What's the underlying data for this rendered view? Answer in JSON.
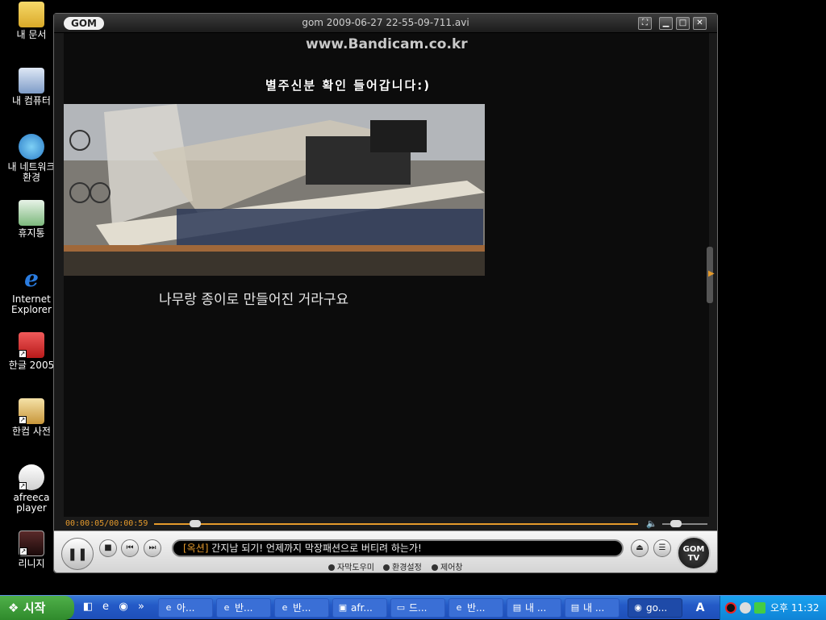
{
  "desktop": {
    "icons": [
      {
        "label": "내 문서",
        "icon": "folder-icon"
      },
      {
        "label": "내 컴퓨터",
        "icon": "computer-icon"
      },
      {
        "label": "내 네트워크 환경",
        "icon": "network-icon"
      },
      {
        "label": "휴지통",
        "icon": "recycle-bin-icon"
      },
      {
        "label": "Internet Explorer",
        "icon": "ie-icon"
      },
      {
        "label": "한글 2005",
        "icon": "hangul-icon"
      },
      {
        "label": "한컴 사전",
        "icon": "dictionary-icon"
      },
      {
        "label": "afreeca player",
        "icon": "afreeca-icon"
      },
      {
        "label": "리니지",
        "icon": "lineage-icon"
      }
    ]
  },
  "player": {
    "logo": "GOM",
    "title": "gom 2009-06-27 22-55-09-711.avi",
    "video": {
      "watermark": "www.Bandicam.co.kr",
      "caption_top": "별주신분 확인 들어갑니다:)",
      "subtitle": "나무랑 종이로 만들어진 거라구요"
    },
    "playback": {
      "timecode": "00:00:05/00:00:59",
      "position_fraction": 0.085,
      "volume_fraction": 0.3
    },
    "ticker": {
      "tag": "[옥션]",
      "text": " 간지남 되기! 언제까지 막장패션으로 버티려 하는가!"
    },
    "links": [
      "자막도우미",
      "환경설정",
      "제어창"
    ],
    "gomtv_label_1": "GOM",
    "gomtv_label_2": "TV"
  },
  "taskbar": {
    "start_label": "시작",
    "tasks": [
      {
        "label": "아...",
        "icon": "ie-icon"
      },
      {
        "label": "반...",
        "icon": "ie-icon"
      },
      {
        "label": "반...",
        "icon": "ie-icon"
      },
      {
        "label": "afr...",
        "icon": "afreeca-icon"
      },
      {
        "label": "드...",
        "icon": "folder-icon"
      },
      {
        "label": "반...",
        "icon": "ie-icon"
      },
      {
        "label": "내 ...",
        "icon": "document-icon"
      },
      {
        "label": "내 ...",
        "icon": "document-icon"
      },
      {
        "label": "go...",
        "icon": "gom-icon"
      }
    ],
    "lang": "A",
    "clock": "오후 11:32"
  }
}
